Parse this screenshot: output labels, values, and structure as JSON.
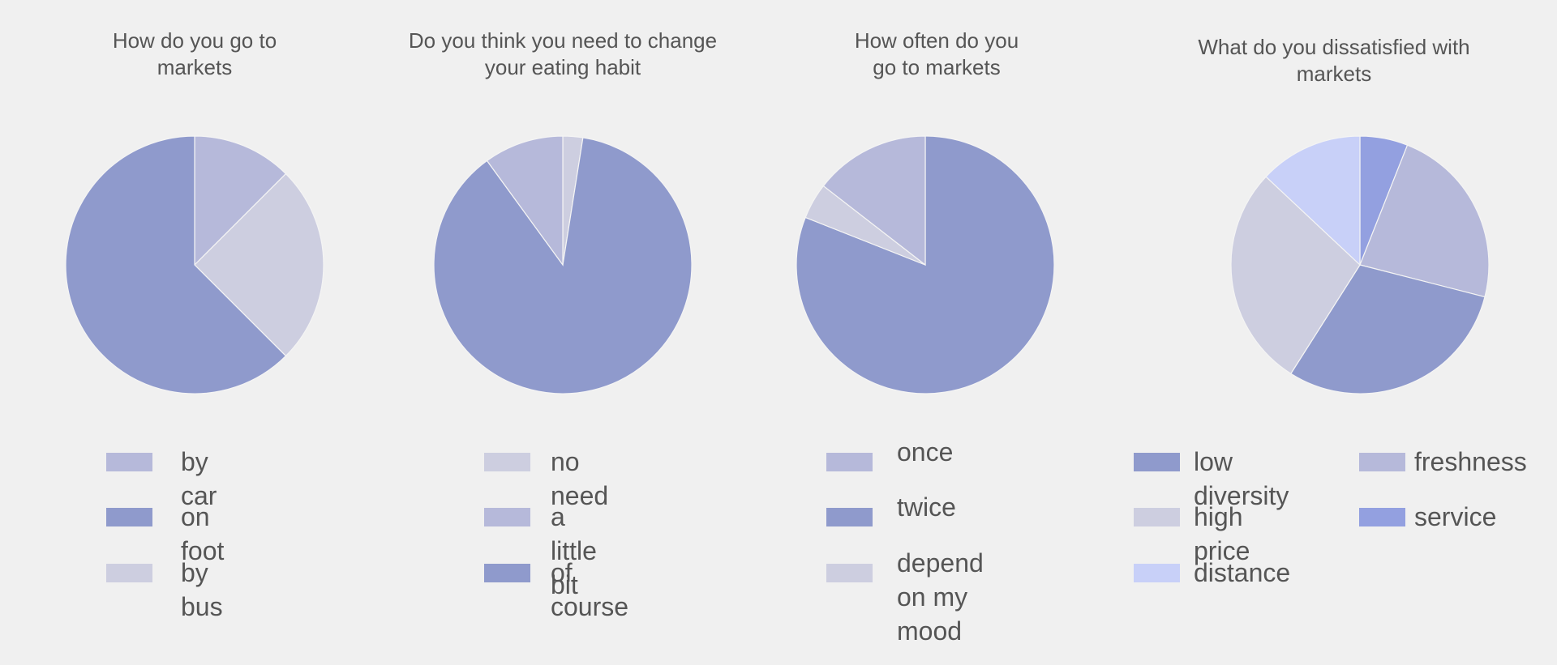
{
  "chart_data": [
    {
      "type": "pie",
      "title": "How do you go to\nmarkets",
      "slices": [
        {
          "label": "by car",
          "value": 12.5,
          "color": "#b6b9da"
        },
        {
          "label": "by bus",
          "value": 25,
          "color": "#cdcee0"
        },
        {
          "label": "on foot",
          "value": 62.5,
          "color": "#8f9acc"
        }
      ],
      "legend": [
        "by car",
        "on foot",
        "by bus"
      ]
    },
    {
      "type": "pie",
      "title": "Do you think you need to change\nyour eating habit",
      "slices": [
        {
          "label": "no need",
          "value": 2.5,
          "color": "#cdcee0"
        },
        {
          "label": "of course",
          "value": 87.5,
          "color": "#8f9acc"
        },
        {
          "label": "a little bit",
          "value": 10,
          "color": "#b6b9da"
        }
      ],
      "legend": [
        "no need",
        "a little bit",
        "of course"
      ]
    },
    {
      "type": "pie",
      "title": "How often do you\ngo to markets",
      "slices": [
        {
          "label": "twice",
          "value": 81,
          "color": "#8f9acc"
        },
        {
          "label": "depend\non my mood",
          "value": 4.5,
          "color": "#cdcee0"
        },
        {
          "label": "once",
          "value": 14.5,
          "color": "#b6b9da"
        }
      ],
      "legend": [
        "once",
        "twice",
        "depend\non my mood"
      ]
    },
    {
      "type": "pie",
      "title": "What do you dissatisfied with\nmarkets",
      "slices": [
        {
          "label": "service",
          "value": 6,
          "color": "#93a0e0"
        },
        {
          "label": "freshness",
          "value": 23,
          "color": "#b6b9da"
        },
        {
          "label": "low diversity",
          "value": 30,
          "color": "#8f9acc"
        },
        {
          "label": "high price",
          "value": 28,
          "color": "#cdcee0"
        },
        {
          "label": "distance",
          "value": 13,
          "color": "#c8d0f8"
        }
      ],
      "legend": [
        "low diversity",
        "freshness",
        "high price",
        "service",
        "distance"
      ]
    }
  ]
}
